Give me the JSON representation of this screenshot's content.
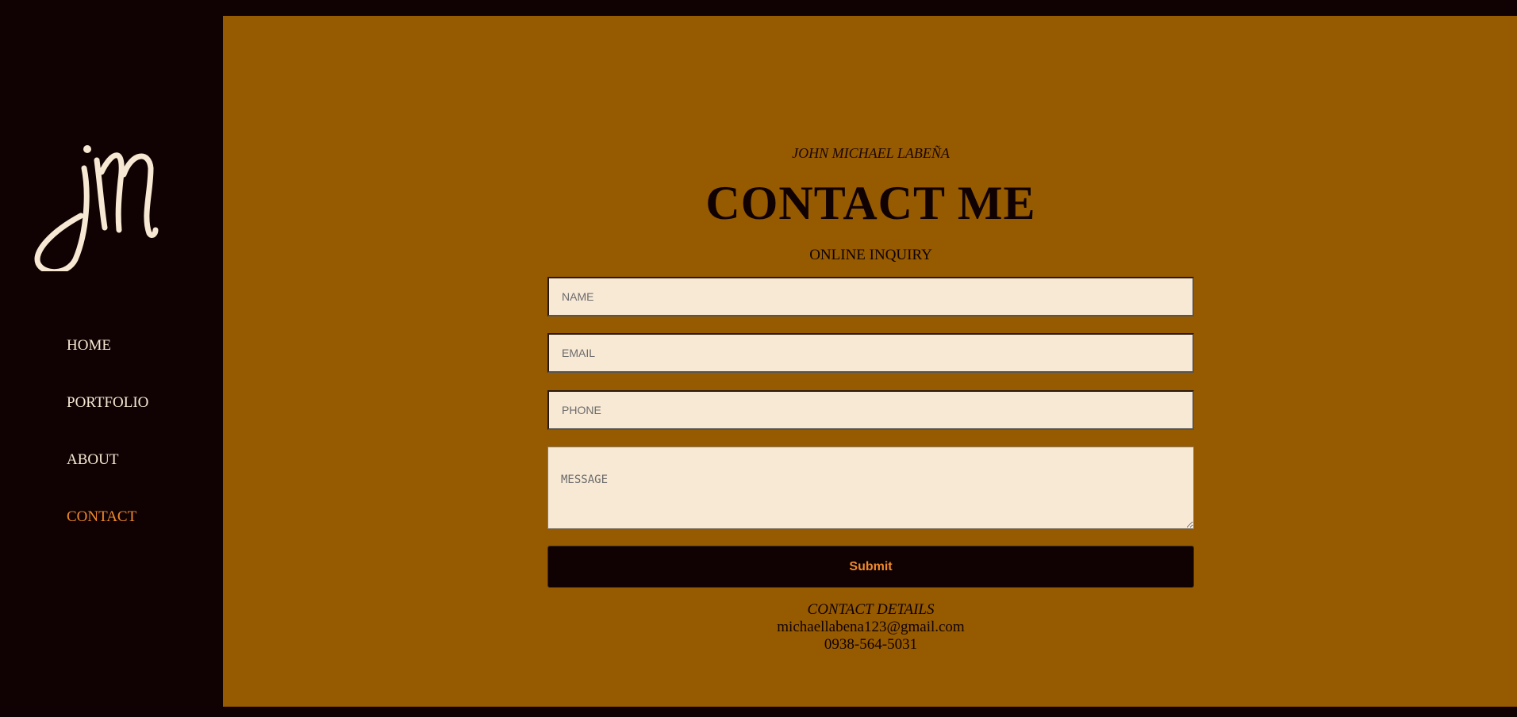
{
  "sidebar": {
    "logo_text": "jm",
    "nav": [
      {
        "label": "HOME",
        "active": false
      },
      {
        "label": "PORTFOLIO",
        "active": false
      },
      {
        "label": "ABOUT",
        "active": false
      },
      {
        "label": "CONTACT",
        "active": true
      }
    ]
  },
  "main": {
    "kicker": "JOHN MICHAEL LABEÑA",
    "title": "CONTACT ME",
    "subtitle": "ONLINE INQUIRY",
    "form": {
      "name_placeholder": "NAME",
      "email_placeholder": "EMAIL",
      "phone_placeholder": "PHONE",
      "message_placeholder": "MESSAGE",
      "submit_label": "Submit"
    },
    "details": {
      "heading": "CONTACT DETAILS",
      "email": "michaellabena123@gmail.com",
      "phone": "0938-564-5031"
    }
  },
  "colors": {
    "sidebar_bg": "#100202",
    "main_bg": "#965a00",
    "field_bg": "#f8e9d5",
    "accent": "#f0892b",
    "nav_text": "#f6e8d3"
  }
}
